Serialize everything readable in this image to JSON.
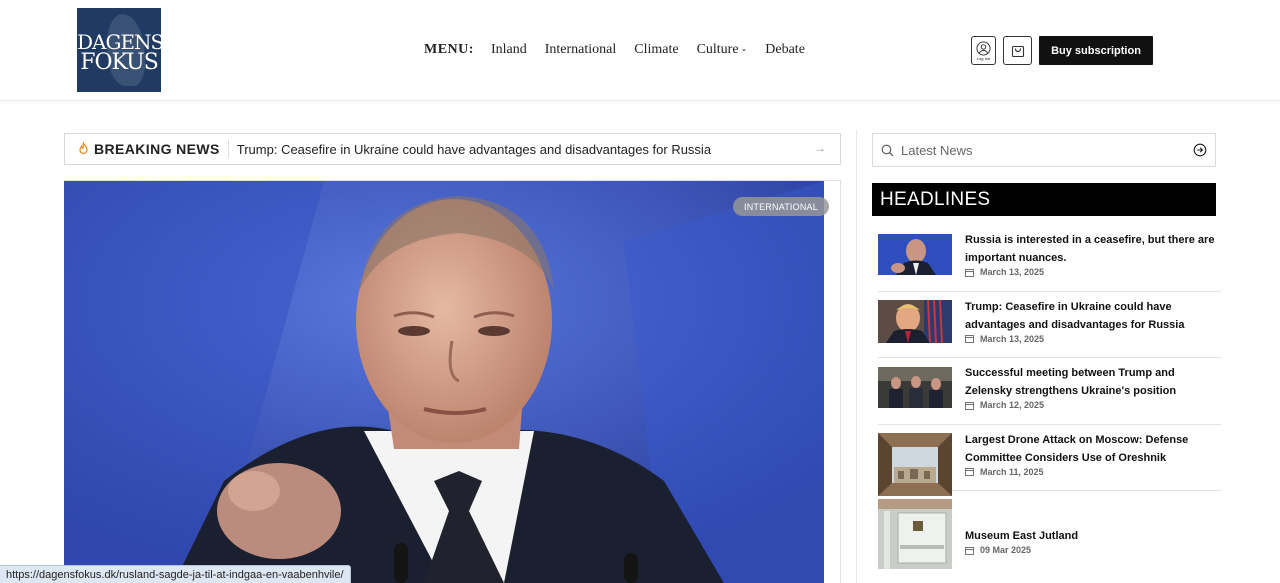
{
  "header": {
    "logo": {
      "line1": "DAGENS",
      "line2": "FOKUS"
    },
    "menu_label": "MENU:",
    "nav": [
      {
        "label": "Inland"
      },
      {
        "label": "International"
      },
      {
        "label": "Climate"
      },
      {
        "label": "Culture",
        "has_dropdown": true
      },
      {
        "label": "Debate"
      }
    ],
    "login_caption": "Log Ind",
    "subscribe_label": "Buy subscription"
  },
  "breaking": {
    "label": "BREAKING NEWS",
    "text": "Trump: Ceasefire in Ukraine could have advantages and disadvantages for Russia"
  },
  "hero": {
    "category": "INTERNATIONAL"
  },
  "sidebar": {
    "search_placeholder": "Latest News",
    "headlines_title": "HEADLINES",
    "items": [
      {
        "title": "Russia is interested in a ceasefire, but there are important nuances.",
        "date": "March 13, 2025"
      },
      {
        "title": "Trump: Ceasefire in Ukraine could have advantages and disadvantages for Russia",
        "date": "March 13, 2025"
      },
      {
        "title": "Successful meeting between Trump and Zelensky strengthens Ukraine's position",
        "date": "March 12, 2025"
      },
      {
        "title": "Largest Drone Attack on Moscow: Defense Committee Considers Use of Oreshnik",
        "date": "March 11, 2025"
      },
      {
        "title": "Museum East Jutland",
        "date": "09 Mar 2025"
      }
    ]
  },
  "status_url": "https://dagensfokus.dk/rusland-sagde-ja-til-at-indgaa-en-vaabenhvile/"
}
